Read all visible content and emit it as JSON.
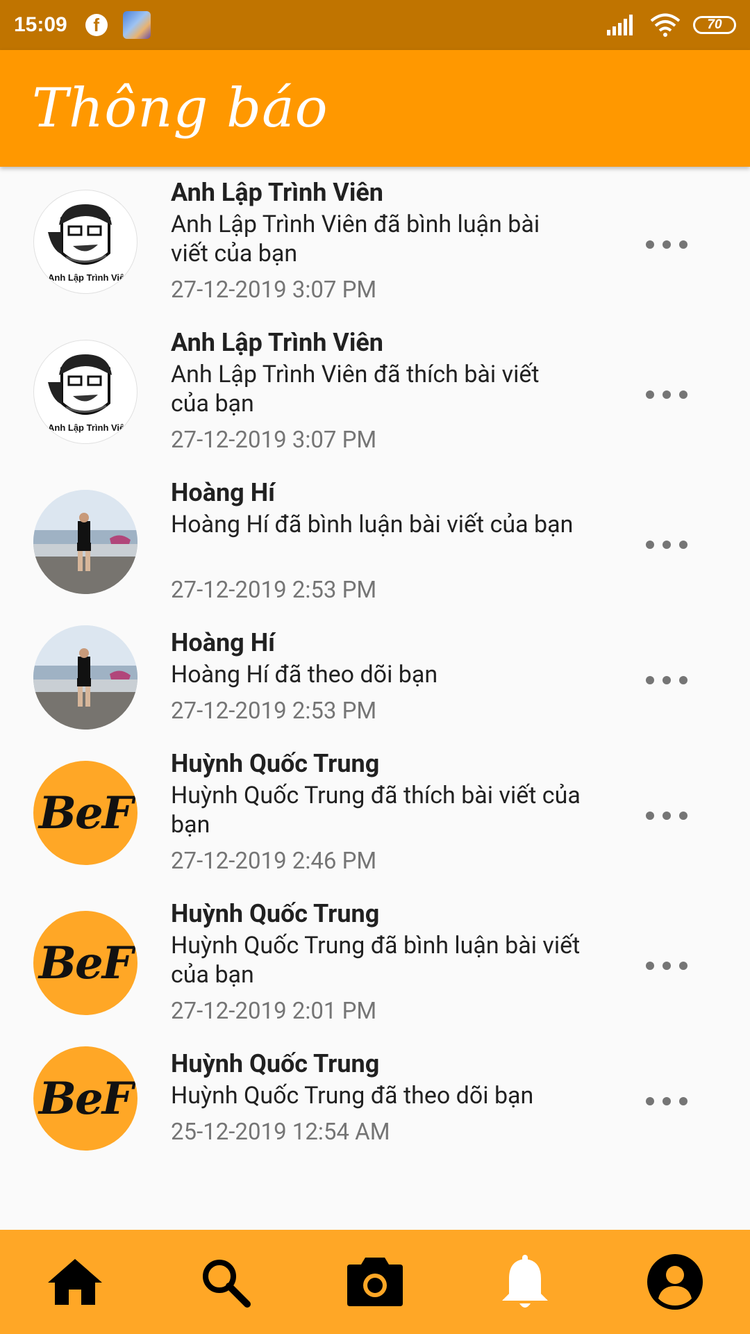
{
  "status_bar": {
    "time": "15:09",
    "facebook_icon": "facebook-icon",
    "battery": "70"
  },
  "app_bar": {
    "title": "Thông báo"
  },
  "notifications": [
    {
      "name": "Anh Lập Trình Viên",
      "message": "Anh Lập Trình Viên đã bình luận bài viết của bạn",
      "time": "27-12-2019 3:07 PM",
      "avatar": "dev",
      "avatar_caption": "Anh Lập Trình Viên"
    },
    {
      "name": "Anh Lập Trình Viên",
      "message": "Anh Lập Trình Viên đã thích bài viết của bạn",
      "time": "27-12-2019 3:07 PM",
      "avatar": "dev",
      "avatar_caption": "Anh Lập Trình Viên"
    },
    {
      "name": "Hoàng Hí",
      "message": "Hoàng Hí đã bình luận bài viết của bạn",
      "time": "27-12-2019 2:53 PM",
      "avatar": "beach"
    },
    {
      "name": "Hoàng Hí",
      "message": "Hoàng Hí đã theo dõi bạn",
      "time": "27-12-2019 2:53 PM",
      "avatar": "beach"
    },
    {
      "name": "Huỳnh Quốc Trung",
      "message": "Huỳnh Quốc Trung đã thích bài viết của bạn",
      "time": "27-12-2019 2:46 PM",
      "avatar": "bef",
      "avatar_text": "BeF"
    },
    {
      "name": "Huỳnh Quốc Trung",
      "message": "Huỳnh Quốc Trung đã bình luận bài viết của bạn",
      "time": "27-12-2019 2:01 PM",
      "avatar": "bef",
      "avatar_text": "BeF"
    },
    {
      "name": "Huỳnh Quốc Trung",
      "message": "Huỳnh Quốc Trung đã theo dõi bạn",
      "time": "25-12-2019 12:54 AM",
      "avatar": "bef",
      "avatar_text": "BeF"
    }
  ],
  "bottom_nav": [
    {
      "icon": "home-icon"
    },
    {
      "icon": "search-icon"
    },
    {
      "icon": "camera-icon"
    },
    {
      "icon": "bell-icon"
    },
    {
      "icon": "account-icon"
    }
  ],
  "colors": {
    "status_bar": "#c07400",
    "app_bar": "#ff9800",
    "bottom_nav": "#ffa726"
  }
}
